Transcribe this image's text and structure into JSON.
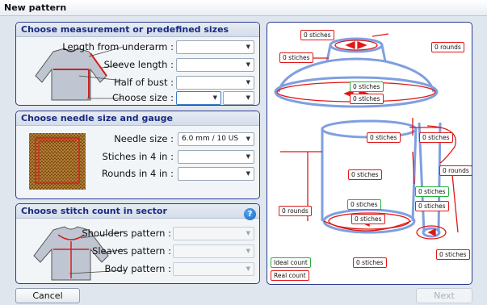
{
  "window": {
    "title": "New pattern"
  },
  "measure": {
    "heading": "Choose measurement  or predefined sizes",
    "length_label": "Length from underarm :",
    "sleeve_label": "Sleeve length :",
    "bust_label": "Half of bust :",
    "size_label": "Choose size :"
  },
  "needle": {
    "heading": "Choose needle size and gauge",
    "needle_label": "Needle size :",
    "needle_value": "6.0 mm / 10 US",
    "stitches_label": "Stiches in 4 in :",
    "rounds_label": "Rounds in 4 in :"
  },
  "stitch": {
    "heading": "Choose stitch count in sector",
    "help": "?",
    "shoulders_label": "Shoulders pattern :",
    "sleeves_label": "Sleaves pattern :",
    "body_label": "Body pattern :"
  },
  "diagram": {
    "top_stiches": "0 stiches",
    "neck_stiches": "0 stiches",
    "neck_rounds": "0 rounds",
    "yoke_ideal": "0 stiches",
    "yoke_real": "0 stiches",
    "body_top_stiches": "0 stiches",
    "sleeve_top_stiches": "0 stiches",
    "body_stiches": "0 stiches",
    "sleeve_rounds": "0 rounds",
    "body_rounds": "0 rounds",
    "sleeve_ideal": "0 stiches",
    "sleeve_real": "0 stiches",
    "body_ideal": "0 stiches",
    "body_real": "0 stiches",
    "body_bottom_stiches": "0 stiches",
    "cuff_stiches": "0 stiches",
    "legend_ideal": "Ideal count",
    "legend_real": "Real count"
  },
  "buttons": {
    "cancel": "Cancel",
    "next": "Next"
  },
  "icons": {
    "dropdown": "▼"
  },
  "colors": {
    "accent": "#2b3a8f",
    "real": "#e01818",
    "ideal": "#27b03e",
    "shape": "#7f9fe0"
  }
}
